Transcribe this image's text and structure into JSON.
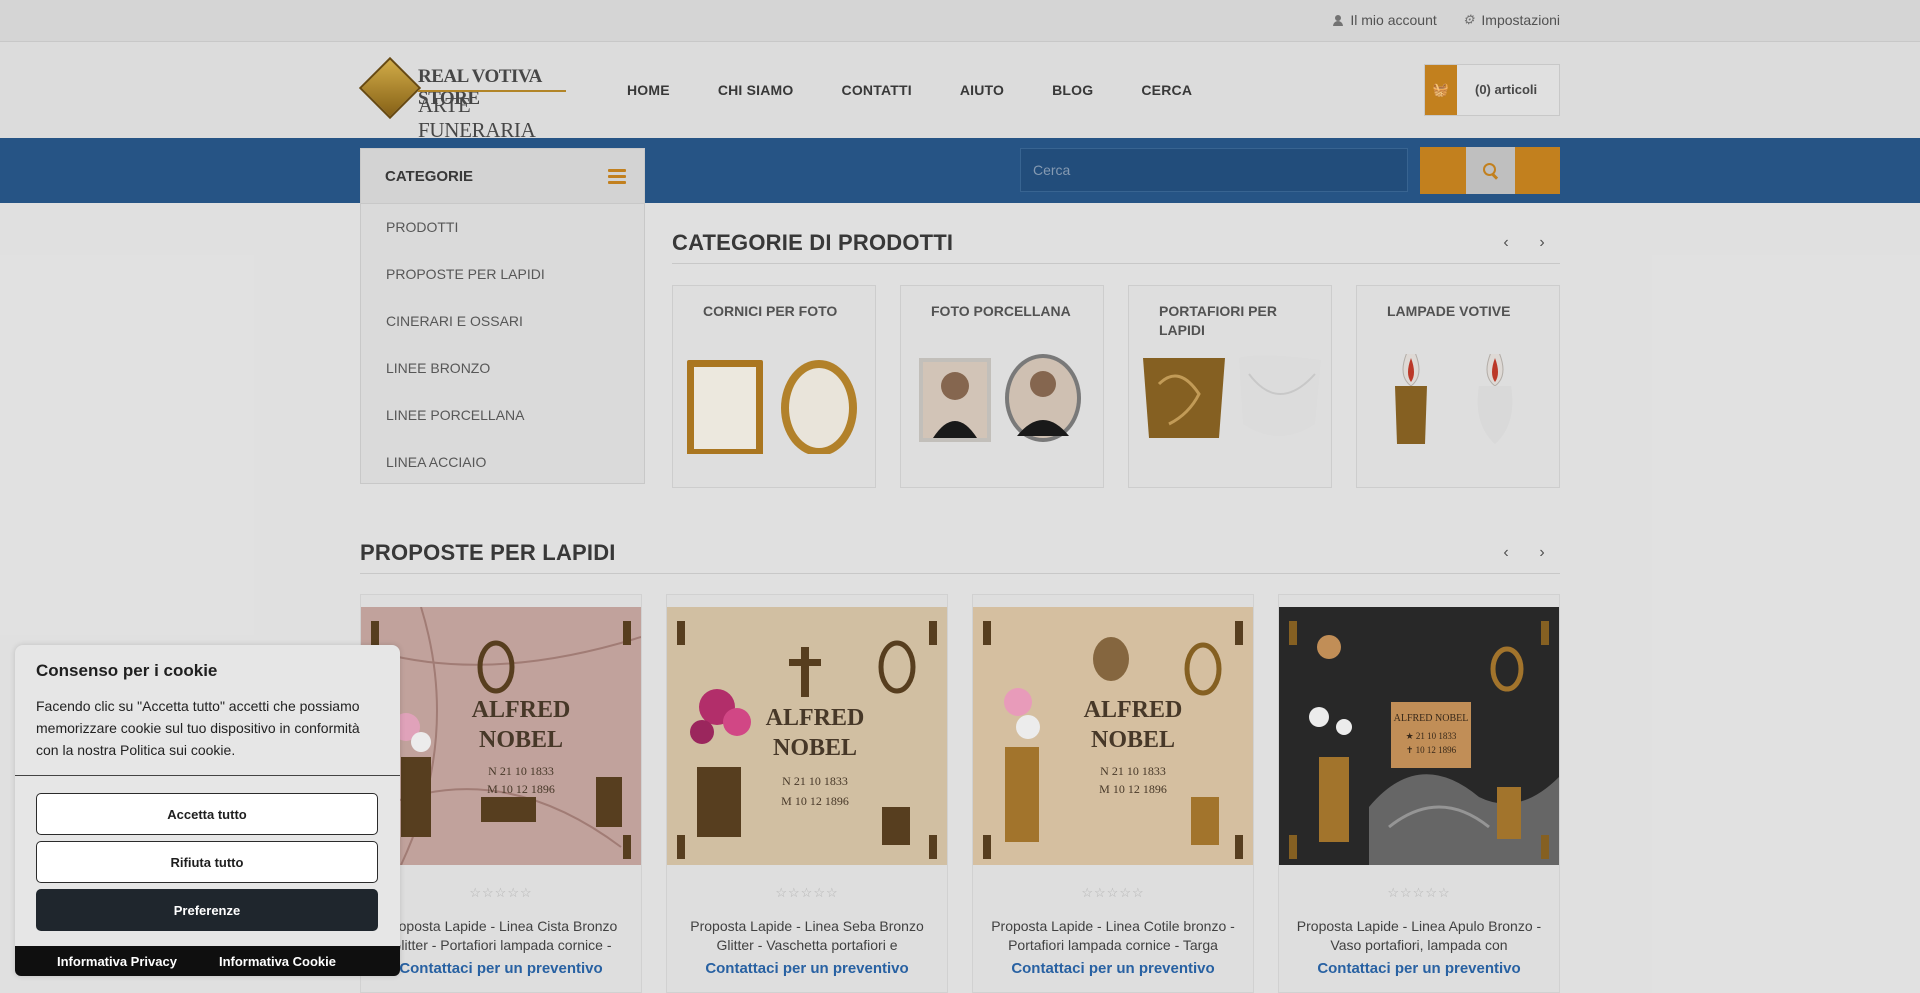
{
  "topbar": {
    "account": "Il mio account",
    "settings": "Impostazioni"
  },
  "logo": {
    "line1": "REAL VOTIVA STORE",
    "line2": "ARTE FUNERARIA"
  },
  "nav": [
    "HOME",
    "CHI SIAMO",
    "CONTATTI",
    "AIUTO",
    "BLOG",
    "CERCA"
  ],
  "cart": {
    "label": "(0) articoli"
  },
  "search": {
    "placeholder": "Cerca"
  },
  "sidebar": {
    "title": "CATEGORIE",
    "items": [
      "PRODOTTI",
      "PROPOSTE PER LAPIDI",
      "CINERARI E OSSARI",
      "LINEE BRONZO",
      "LINEE PORCELLANA",
      "LINEA ACCIAIO"
    ]
  },
  "categories_section": {
    "title": "CATEGORIE DI PRODOTTI",
    "cards": [
      "CORNICI PER FOTO",
      "FOTO PORCELLANA",
      "PORTAFIORI PER LAPIDI",
      "LAMPADE VOTIVE"
    ]
  },
  "products_section": {
    "title": "PROPOSTE PER LAPIDI",
    "cta": "Contattaci per un preventivo",
    "stars": "☆☆☆☆☆",
    "products": [
      "Proposta Lapide - Linea Cista Bronzo Glitter - Portafiori lampada cornice -",
      "Proposta Lapide - Linea Seba Bronzo Glitter - Vaschetta portafiori e",
      "Proposta Lapide - Linea Cotile bronzo - Portafiori lampada cornice - Targa",
      "Proposta Lapide - Linea Apulo Bronzo - Vaso portafiori, lampada con"
    ],
    "plaque_text": {
      "name1": "ALFRED",
      "name2": "NOBEL",
      "born": "N 21 10 1833",
      "died": "M 10 12 1896",
      "small_name": "ALFRED NOBEL",
      "small_born": "★ 21 10 1833",
      "small_died": "✝ 10 12 1896"
    }
  },
  "cookie": {
    "title": "Consenso per i cookie",
    "body": "Facendo clic su \"Accetta tutto\" accetti che possiamo memorizzare cookie sul tuo dispositivo in conformità con la nostra Politica sui cookie.",
    "accept": "Accetta tutto",
    "reject": "Rifiuta tutto",
    "prefs": "Preferenze",
    "privacy": "Informativa Privacy",
    "cookie_policy": "Informativa Cookie"
  },
  "colors": {
    "accent": "#c9851f",
    "band": "#28578a",
    "link": "#2a65a8"
  }
}
